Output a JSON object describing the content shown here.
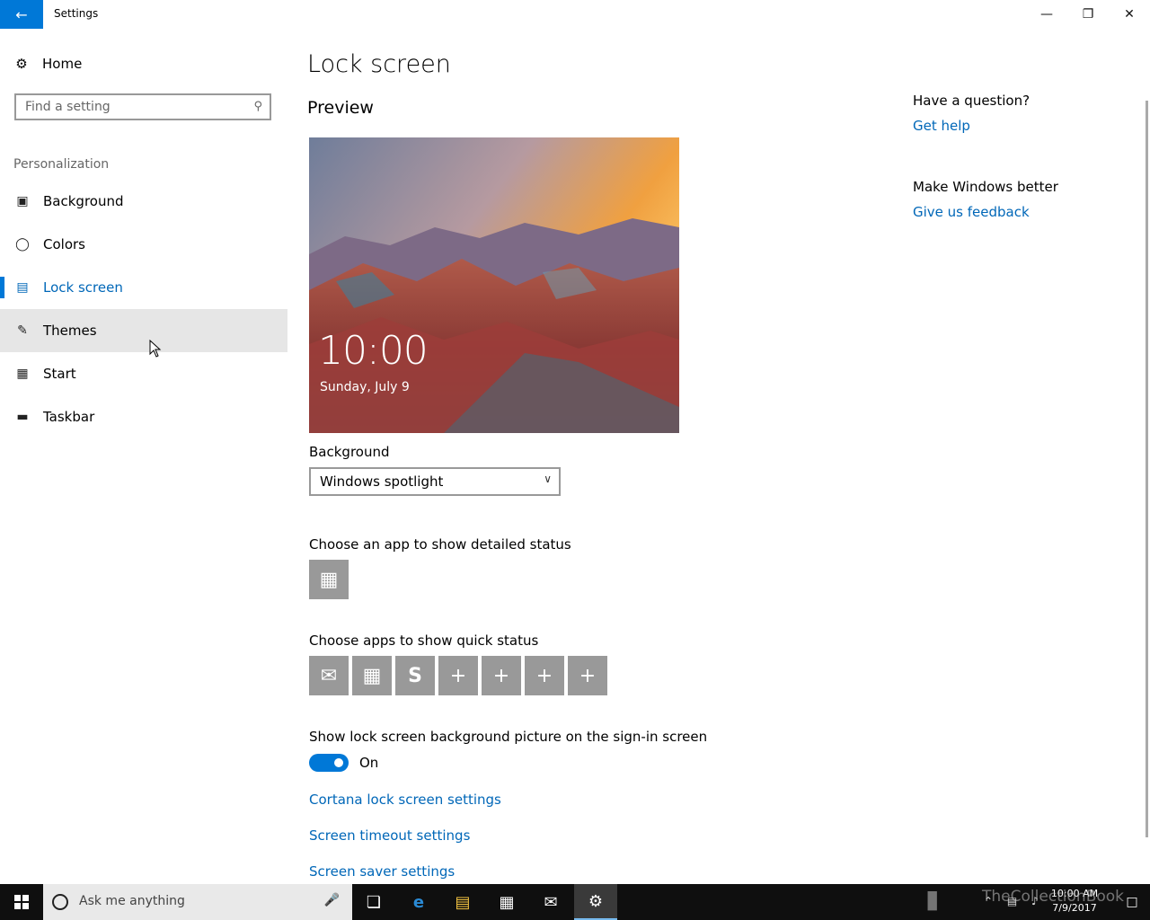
{
  "window": {
    "title": "Settings",
    "back_icon": "arrow-left-icon",
    "accent": "#0078d7"
  },
  "sidebar": {
    "home_label": "Home",
    "search_placeholder": "Find a setting",
    "section": "Personalization",
    "items": [
      {
        "label": "Background",
        "icon": "picture-icon"
      },
      {
        "label": "Colors",
        "icon": "palette-icon"
      },
      {
        "label": "Lock screen",
        "icon": "lock-screen-icon",
        "active": true
      },
      {
        "label": "Themes",
        "icon": "brush-icon",
        "hover": true
      },
      {
        "label": "Start",
        "icon": "start-tiles-icon"
      },
      {
        "label": "Taskbar",
        "icon": "taskbar-icon"
      }
    ]
  },
  "main": {
    "title": "Lock screen",
    "preview_heading": "Preview",
    "preview_time": "10:00",
    "preview_date": "Sunday, July 9",
    "background_label": "Background",
    "background_value": "Windows spotlight",
    "detailed_status_label": "Choose an app to show detailed status",
    "quick_status_label": "Choose apps to show quick status",
    "quick_status_tiles": [
      "mail-icon",
      "calendar-icon",
      "skype-icon",
      "plus-icon",
      "plus-icon",
      "plus-icon",
      "plus-icon"
    ],
    "signin_label": "Show lock screen background picture on the sign-in screen",
    "signin_toggle": "On",
    "links": [
      "Cortana lock screen settings",
      "Screen timeout settings",
      "Screen saver settings"
    ]
  },
  "help": {
    "question": "Have a question?",
    "get_help": "Get help",
    "better": "Make Windows better",
    "feedback": "Give us feedback"
  },
  "taskbar": {
    "search_placeholder": "Ask me anything",
    "time": "10:00 AM",
    "date": "7/9/2017",
    "watermark": "TheCollectionBook"
  }
}
